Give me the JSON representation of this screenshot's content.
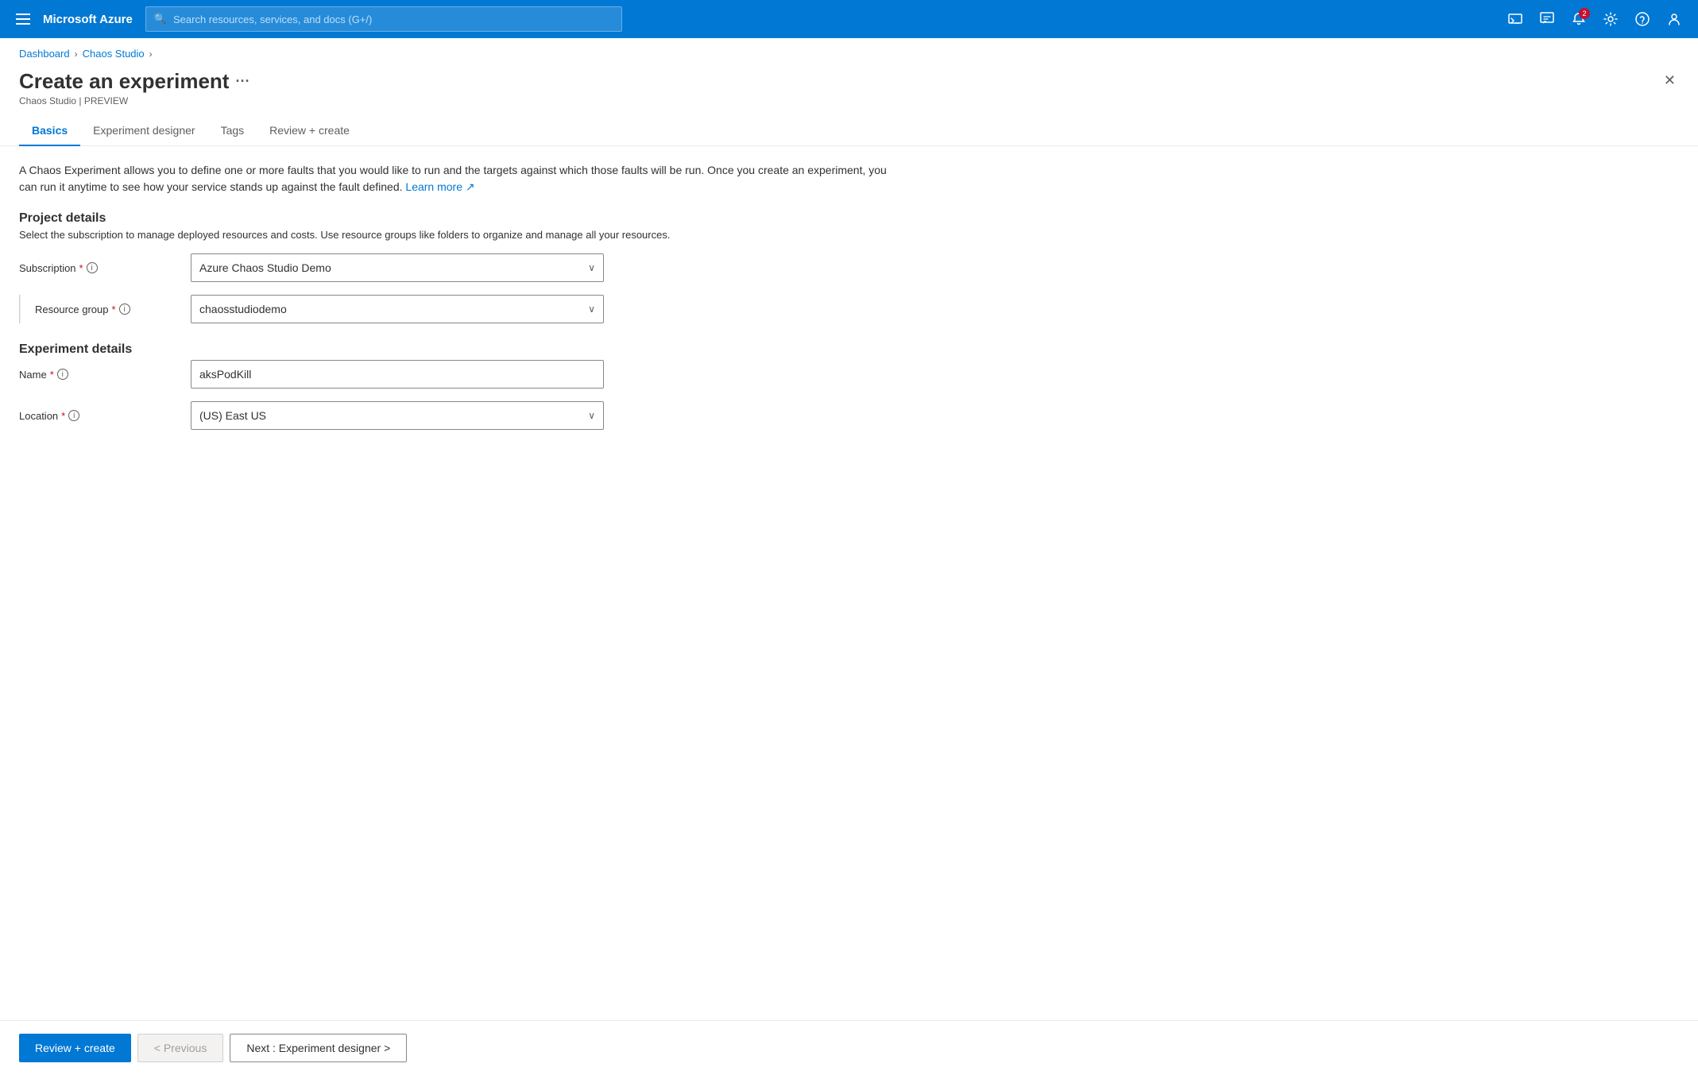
{
  "topbar": {
    "brand": "Microsoft Azure",
    "search_placeholder": "Search resources, services, and docs (G+/)",
    "notification_badge": "2"
  },
  "breadcrumb": {
    "items": [
      "Dashboard",
      "Chaos Studio"
    ]
  },
  "page": {
    "title": "Create an experiment",
    "subtitle": "Chaos Studio | PREVIEW",
    "description": "A Chaos Experiment allows you to define one or more faults that you would like to run and the targets against which those faults will be run. Once you create an experiment, you can run it anytime to see how your service stands up against the fault defined.",
    "learn_more": "Learn more"
  },
  "tabs": [
    {
      "id": "basics",
      "label": "Basics",
      "active": true
    },
    {
      "id": "experiment-designer",
      "label": "Experiment designer",
      "active": false
    },
    {
      "id": "tags",
      "label": "Tags",
      "active": false
    },
    {
      "id": "review-create",
      "label": "Review + create",
      "active": false
    }
  ],
  "project_details": {
    "title": "Project details",
    "subtitle": "Select the subscription to manage deployed resources and costs. Use resource groups like folders to organize and manage all your resources.",
    "subscription_label": "Subscription",
    "subscription_value": "Azure Chaos Studio Demo",
    "resource_group_label": "Resource group",
    "resource_group_value": "chaosstudiodemo"
  },
  "experiment_details": {
    "title": "Experiment details",
    "name_label": "Name",
    "name_value": "aksPodKill",
    "location_label": "Location",
    "location_value": "(US) East US"
  },
  "footer": {
    "review_create": "Review + create",
    "previous": "< Previous",
    "next": "Next : Experiment designer >"
  }
}
